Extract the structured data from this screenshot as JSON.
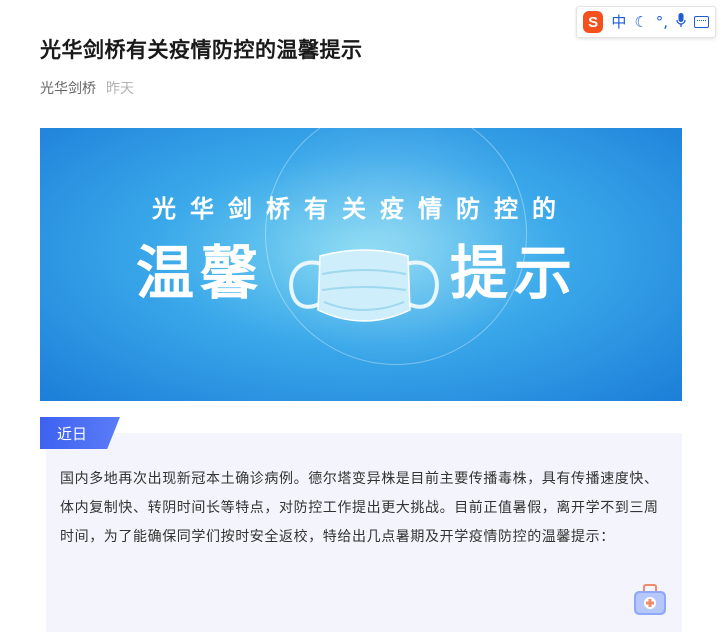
{
  "ime": {
    "logo": "S",
    "mode": "中",
    "moon_icon": "moon-icon",
    "punct": "°,",
    "mic_icon": "microphone-icon",
    "keyboard_icon": "keyboard-icon"
  },
  "article": {
    "title": "光华剑桥有关疫情防控的温馨提示",
    "author": "光华剑桥",
    "date": "昨天"
  },
  "banner": {
    "line1": "光华剑桥有关疫情防控的",
    "big_left": "温馨",
    "big_right": "提示",
    "mask_icon": "face-mask-icon"
  },
  "section": {
    "tag": "近日",
    "body": "国内多地再次出现新冠本土确诊病例。德尔塔变异株是目前主要传播毒株，具有传播速度快、体内复制快、转阴时间长等特点，对防控工作提出更大挑战。目前正值暑假，离开学不到三周时间，为了能确保同学们按时安全返校，特给出几点暑期及开学疫情防控的温馨提示：",
    "kit_icon": "medical-kit-icon"
  },
  "colors": {
    "accent": "#3d62f0",
    "banner_blue": "#1c7ed8",
    "card_bg": "#f4f5fc"
  }
}
